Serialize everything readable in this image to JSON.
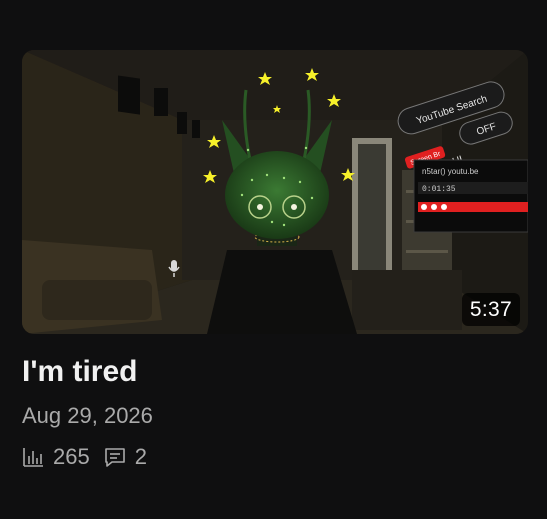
{
  "video": {
    "title": "I'm tired",
    "date": "Aug 29, 2026",
    "duration": "5:37",
    "views": "265",
    "comments": "2"
  },
  "thumbnail": {
    "overlay_texts": {
      "youtube_search": "YouTube Search",
      "off": "OFF",
      "ui": "UI",
      "screen_br": "Screen Br",
      "url": "n5tar() youtu.be",
      "time": "0:01:35"
    }
  },
  "icons": {
    "views": "bar-chart-icon",
    "comments": "comment-icon",
    "mic": "microphone-icon"
  },
  "colors": {
    "background": "#0f0f10",
    "title": "#f1f1f1",
    "meta": "#aaaaaa",
    "accent_red": "#e02020",
    "star": "#f7f12a",
    "avatar_green": "#2f6b2a"
  }
}
